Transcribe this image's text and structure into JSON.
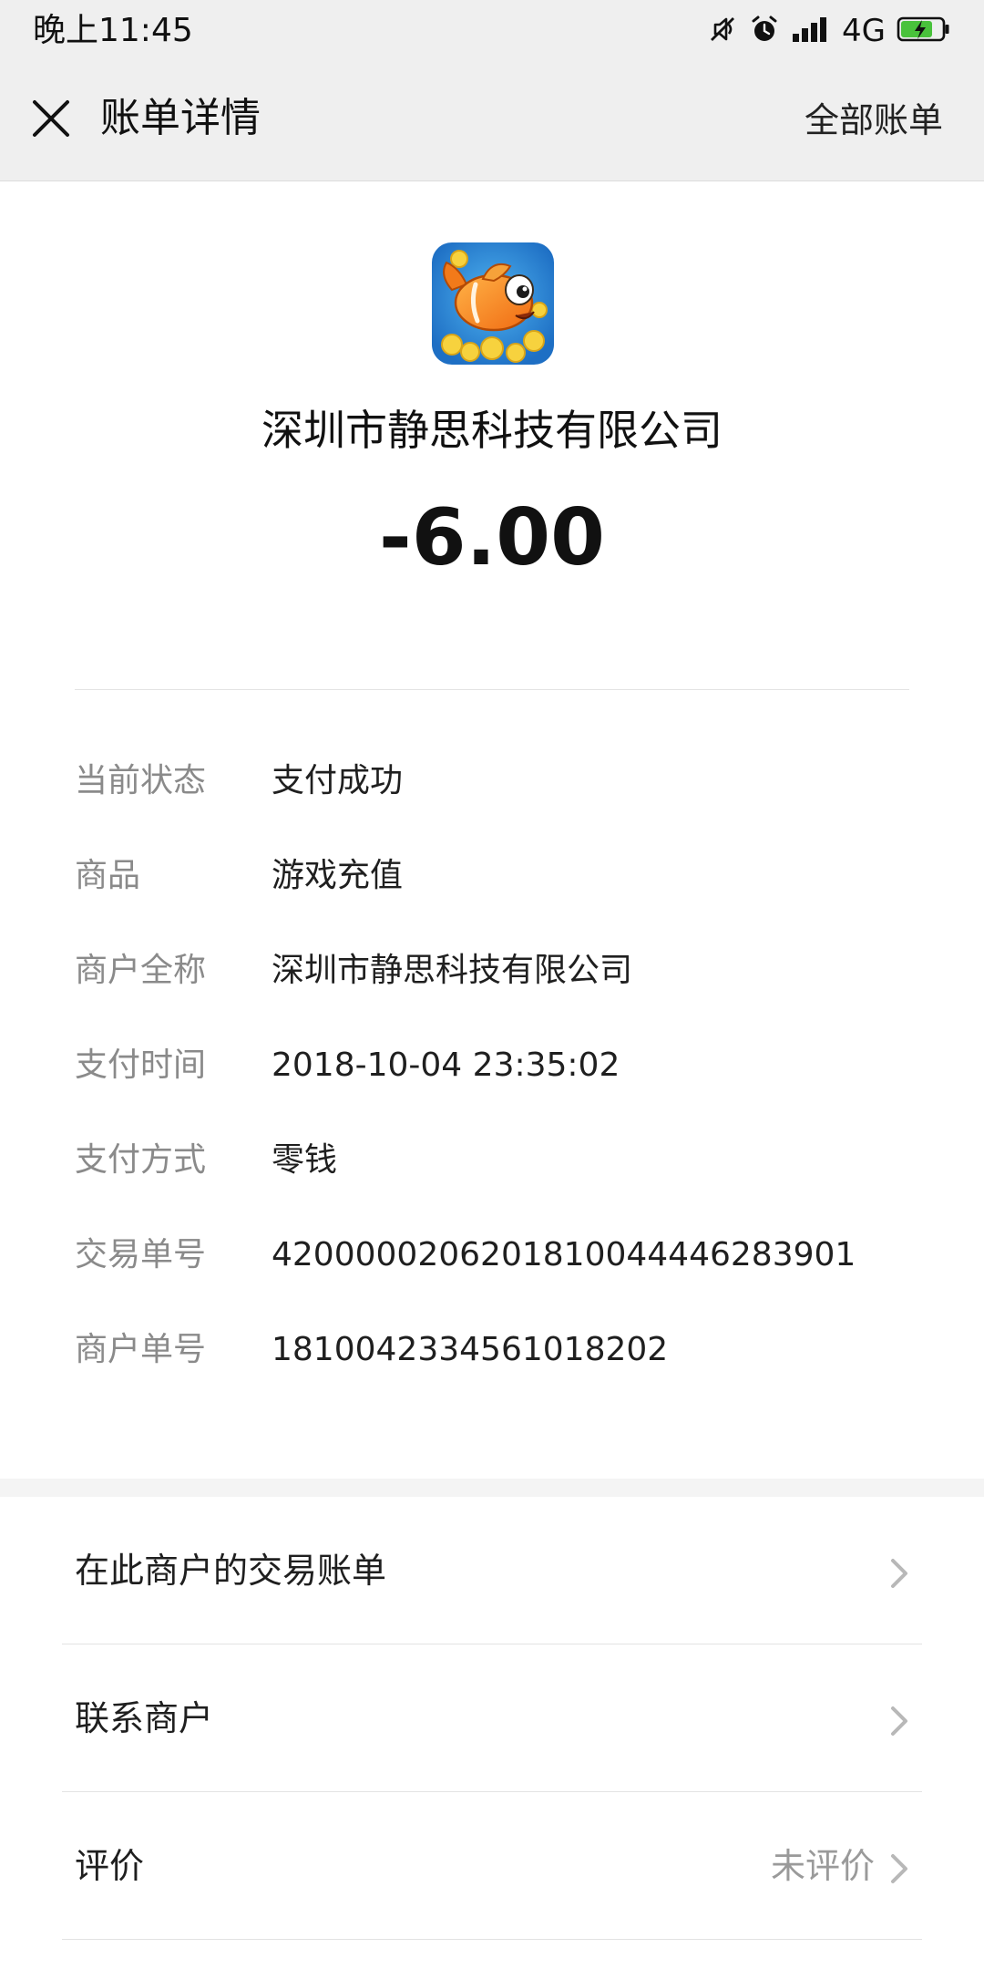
{
  "status_bar": {
    "time": "晚上11:45",
    "network": "4G",
    "icons": [
      "mute-icon",
      "alarm-icon",
      "signal-icon",
      "battery-charging-icon"
    ]
  },
  "nav": {
    "title": "账单详情",
    "close_icon": "close-icon",
    "action_label": "全部账单"
  },
  "merchant": {
    "logo": "goldfish-game-logo",
    "name": "深圳市静思科技有限公司",
    "amount": "-6.00"
  },
  "details": [
    {
      "label": "当前状态",
      "value": "支付成功"
    },
    {
      "label": "商品",
      "value": "游戏充值"
    },
    {
      "label": "商户全称",
      "value": "深圳市静思科技有限公司"
    },
    {
      "label": "支付时间",
      "value": "2018-10-04 23:35:02"
    },
    {
      "label": "支付方式",
      "value": "零钱"
    },
    {
      "label": "交易单号",
      "value": "4200000206201810044446283901"
    },
    {
      "label": "商户单号",
      "value": "1810042334561018202"
    }
  ],
  "menu": [
    {
      "label": "在此商户的交易账单",
      "value": ""
    },
    {
      "label": "联系商户",
      "value": ""
    },
    {
      "label": "评价",
      "value": "未评价"
    }
  ],
  "colors": {
    "header_bg": "#efefef",
    "label_gray": "#8a8a8a",
    "text": "#1f1f1f",
    "battery_green": "#49c23b"
  }
}
